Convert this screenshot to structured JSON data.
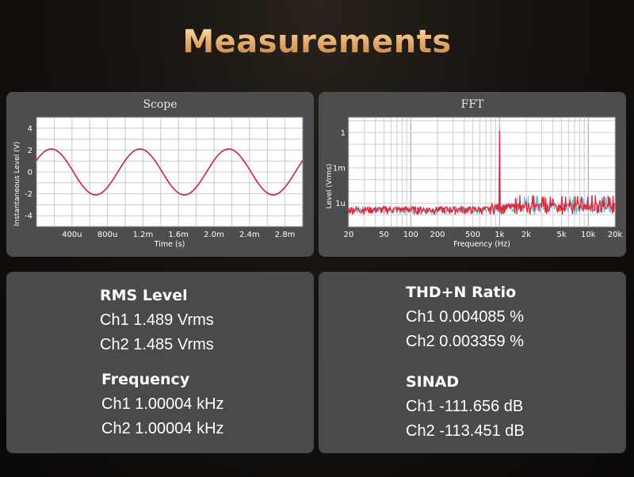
{
  "title": "Measurements",
  "scope": {
    "title": "Scope"
  },
  "fft": {
    "title": "FFT"
  },
  "chart_data": [
    {
      "type": "line",
      "title": "Scope",
      "xlabel": "Time (s)",
      "ylabel": "Instantaneous Level (V)",
      "x_ticks": [
        0.0004,
        0.0008,
        0.0012,
        0.0016,
        0.002,
        0.0024,
        0.0028
      ],
      "x_tick_labels": [
        "400u",
        "800u",
        "1.2m",
        "1.6m",
        "2.0m",
        "2.4m",
        "2.8m"
      ],
      "y_ticks": [
        4,
        2,
        0,
        -2,
        -4
      ],
      "y_tick_labels": [
        "4",
        "2",
        "0",
        "-2",
        "-4"
      ],
      "xlim": [
        0,
        0.003
      ],
      "ylim": [
        -5,
        5
      ],
      "grid": true,
      "series": [
        {
          "color": "#c8243c",
          "amplitude": 2.1,
          "frequency_hz": 1000,
          "phase_deg": 30
        }
      ]
    },
    {
      "type": "line",
      "title": "FFT",
      "xlabel": "Frequency (Hz)",
      "ylabel": "Level  (Vrms)",
      "x_scale": "log",
      "y_scale": "log",
      "x_ticks": [
        20,
        50,
        100,
        200,
        500,
        1000,
        2000,
        5000,
        10000,
        20000
      ],
      "x_tick_labels": [
        "20",
        "50",
        "100",
        "200",
        "500",
        "1k",
        "2k",
        "5k",
        "10k",
        "20k"
      ],
      "y_ticks": [
        1,
        0.001,
        1e-06
      ],
      "y_tick_labels": [
        "1",
        "1m",
        "1u"
      ],
      "xlim": [
        20,
        20000
      ],
      "ylim": [
        1e-08,
        20
      ],
      "grid": true,
      "series": [
        {
          "color": "#6fb7d6",
          "peaks": [
            [
              1000,
              1.48
            ],
            [
              2000,
              1.5e-06
            ],
            [
              3000,
              3e-06
            ]
          ],
          "floor_v": 3e-07
        },
        {
          "color": "#e0202c",
          "peaks": [
            [
              1000,
              1.49
            ],
            [
              2000,
              1.5e-06
            ],
            [
              3000,
              3e-06
            ]
          ],
          "floor_v": 3e-07
        }
      ]
    }
  ],
  "metrics": {
    "rms": {
      "heading": "RMS Level",
      "ch1": "Ch1 1.489 Vrms",
      "ch2": "Ch2 1.485 Vrms"
    },
    "frequency": {
      "heading": "Frequency",
      "ch1": "Ch1 1.00004 kHz",
      "ch2": "Ch2 1.00004 kHz"
    },
    "thd": {
      "heading": "THD+N Ratio",
      "ch1": "Ch1 0.004085 %",
      "ch2": "Ch2 0.003359 %"
    },
    "sinad": {
      "heading": "SINAD",
      "ch1": "Ch1 -111.656 dB",
      "ch2": "Ch2 -113.451 dB"
    }
  }
}
